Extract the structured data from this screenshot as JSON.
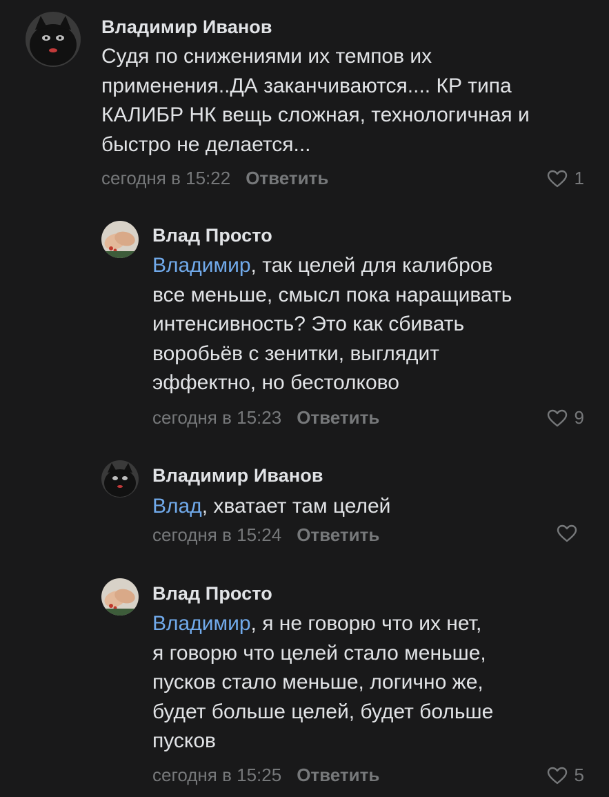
{
  "comments": [
    {
      "author": "Владимир Иванов",
      "mention": "",
      "lines": [
        "Судя по снижениями их темпов их",
        "применения..ДА заканчиваются.... КР типа",
        "КАЛИБР НК вещь сложная, технологичная и",
        "быстро не делается..."
      ],
      "time": "сегодня в 15:22",
      "reply": "Ответить",
      "likes": "1"
    },
    {
      "author": "Влад Просто",
      "mention": "Владимир",
      "lines": [
        ", так целей для калибров",
        "все меньше, смысл пока наращивать",
        "интенсивность? Это как сбивать",
        "воробьёв с зенитки, выглядит",
        "эффектно, но бестолково"
      ],
      "time": "сегодня в 15:23",
      "reply": "Ответить",
      "likes": "9"
    },
    {
      "author": "Владимир Иванов",
      "mention": "Влад",
      "lines": [
        ", хватает там целей"
      ],
      "time": "сегодня в 15:24",
      "reply": "Ответить",
      "likes": ""
    },
    {
      "author": "Влад Просто",
      "mention": "Владимир",
      "lines": [
        ", я не говорю что их нет,",
        "я говорю что целей стало меньше,",
        "пусков стало меньше, логично же,",
        "будет больше целей, будет больше",
        "пусков"
      ],
      "time": "сегодня в 15:25",
      "reply": "Ответить",
      "likes": "5"
    }
  ],
  "icons": {
    "like": "heart-outline-icon",
    "avatar_ivanov": "black-cat-avatar",
    "avatar_vlad": "hands-avatar"
  },
  "colors": {
    "background": "#19191a",
    "text": "#e1e3e6",
    "secondary": "#76787a",
    "mention": "#71aaeb"
  }
}
